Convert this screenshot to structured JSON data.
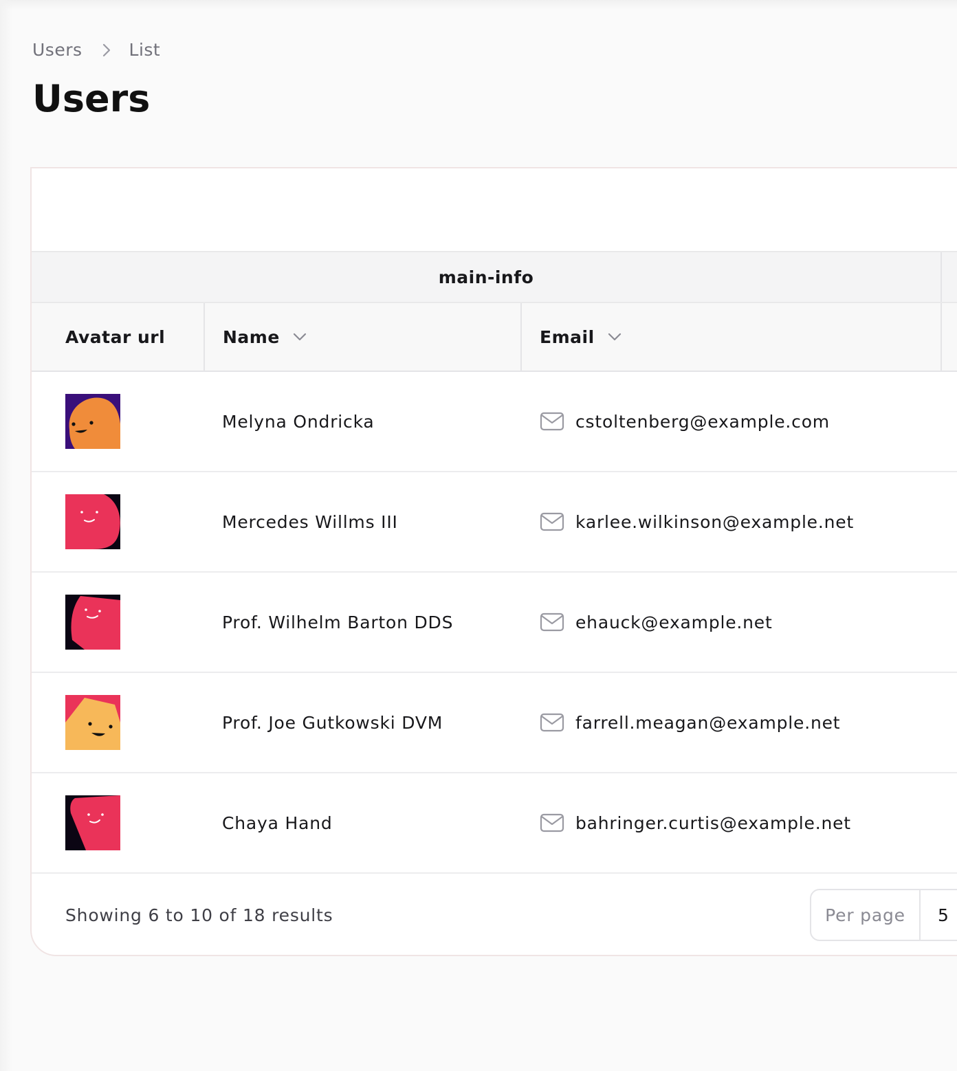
{
  "breadcrumb": {
    "items": [
      "Users",
      "List"
    ]
  },
  "page": {
    "title": "Users"
  },
  "table": {
    "group_header": "main-info",
    "columns": [
      {
        "label": "Avatar url"
      },
      {
        "label": "Name"
      },
      {
        "label": "Email"
      }
    ],
    "rows": [
      {
        "name": "Melyna Ondricka",
        "email": "cstoltenberg@example.com",
        "avatar": {
          "bg": "#3a0f7a",
          "shape": "#f08c3a"
        }
      },
      {
        "name": "Mercedes Willms III",
        "email": "karlee.wilkinson@example.net",
        "avatar": {
          "bg": "#0b0513",
          "shape": "#ea3359"
        }
      },
      {
        "name": "Prof. Wilhelm Barton DDS",
        "email": "ehauck@example.net",
        "avatar": {
          "bg": "#0b0513",
          "shape": "#ea3359"
        }
      },
      {
        "name": "Prof. Joe Gutkowski DVM",
        "email": "farrell.meagan@example.net",
        "avatar": {
          "bg": "#ea3359",
          "shape": "#f7b859"
        }
      },
      {
        "name": "Chaya Hand",
        "email": "bahringer.curtis@example.net",
        "avatar": {
          "bg": "#0b0513",
          "shape": "#ea3359"
        }
      }
    ]
  },
  "footer": {
    "results_text": "Showing 6 to 10 of 18 results",
    "per_page_label": "Per page",
    "per_page_value": "5"
  }
}
